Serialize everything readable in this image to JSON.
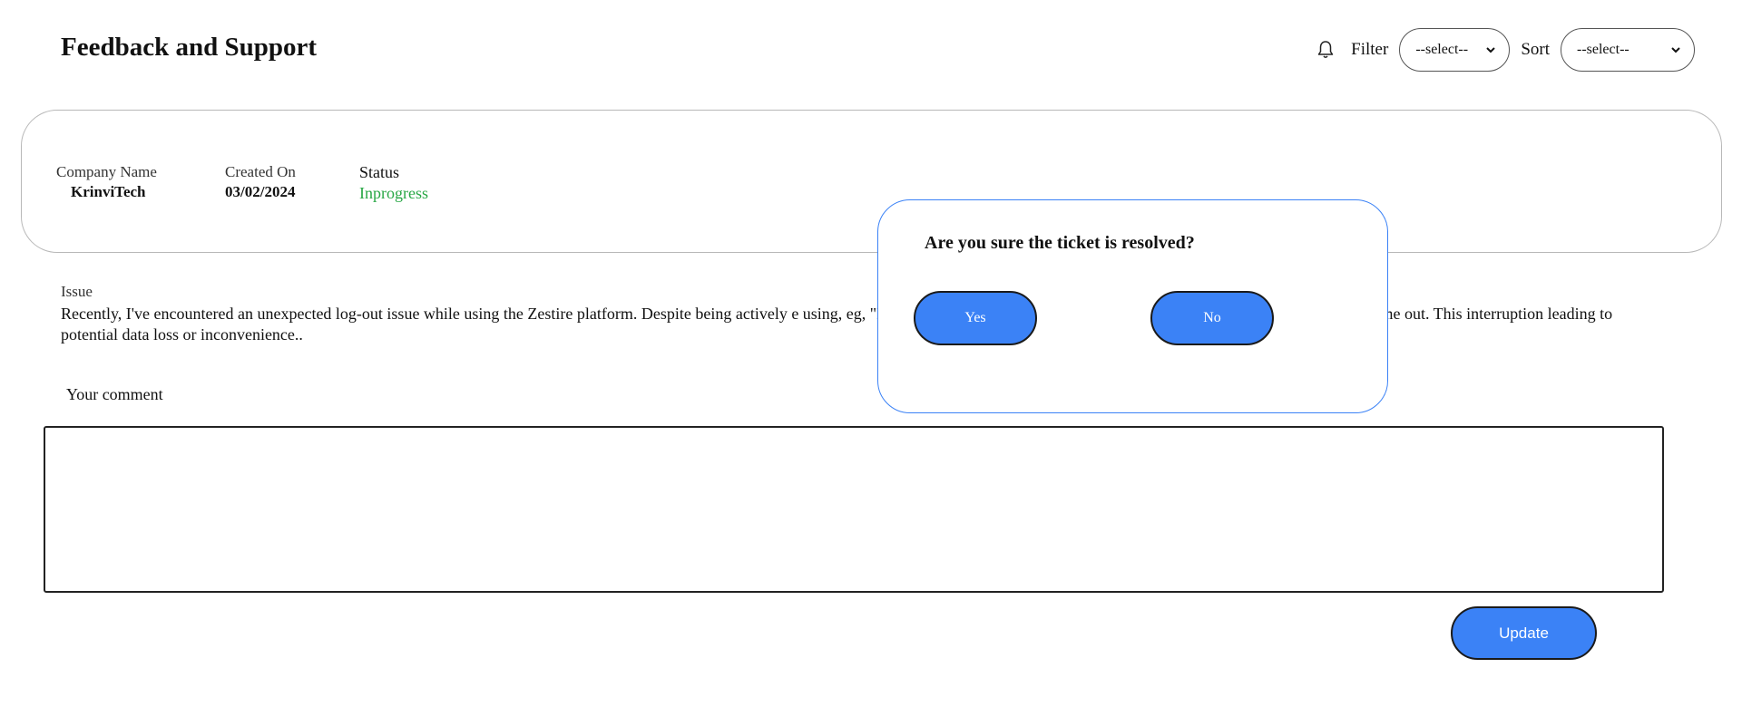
{
  "header": {
    "title": "Feedback and Support",
    "bell_icon": "bell-icon",
    "filter_label": "Filter",
    "filter_value": "--select--",
    "sort_label": "Sort",
    "sort_value": "--select--"
  },
  "ticket": {
    "company_label": "Company Name",
    "company_value": "KrinviTech",
    "created_label": "Created On",
    "created_value": "03/02/2024",
    "status_label": "Status",
    "status_value": "Inprogress",
    "status_color": "#28a745"
  },
  "issue": {
    "label": "Issue",
    "text": "Recently, I've encountered an unexpected log-out issue while using the Zestire platform. Despite being actively e using, eg, \"Resource Hire Cycle\" or \"Job Application'], the system unexpectedly logged me out. This interruption leading to potential data loss or inconvenience.."
  },
  "comment": {
    "label": "Your comment",
    "value": ""
  },
  "actions": {
    "update_label": "Update"
  },
  "modal": {
    "title": "Are you sure the ticket is resolved?",
    "yes_label": "Yes",
    "no_label": "No"
  },
  "colors": {
    "accent": "#3b82f6",
    "status_green": "#28a745"
  }
}
